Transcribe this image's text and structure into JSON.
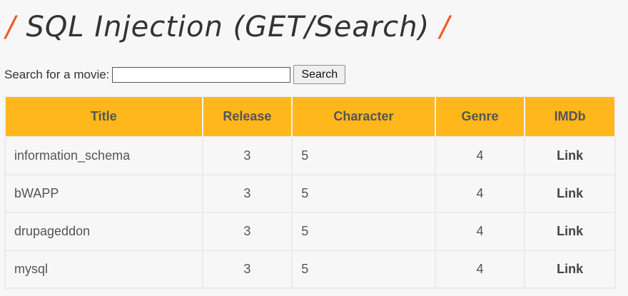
{
  "header": {
    "slash_left": "/",
    "title": "SQL Injection (GET/Search)",
    "slash_right": "/"
  },
  "search": {
    "label": "Search for a movie:",
    "value": "",
    "placeholder": "",
    "button_label": "Search"
  },
  "table": {
    "columns": [
      "Title",
      "Release",
      "Character",
      "Genre",
      "IMDb"
    ],
    "rows": [
      {
        "title": "information_schema",
        "release": "3",
        "character": "5",
        "genre": "4",
        "imdb": "Link"
      },
      {
        "title": "bWAPP",
        "release": "3",
        "character": "5",
        "genre": "4",
        "imdb": "Link"
      },
      {
        "title": "drupageddon",
        "release": "3",
        "character": "5",
        "genre": "4",
        "imdb": "Link"
      },
      {
        "title": "mysql",
        "release": "3",
        "character": "5",
        "genre": "4",
        "imdb": "Link"
      }
    ]
  },
  "colors": {
    "header_bg": "#ffb71b",
    "slash_accent": "#f15a24",
    "page_bg": "#f7f7f7"
  }
}
